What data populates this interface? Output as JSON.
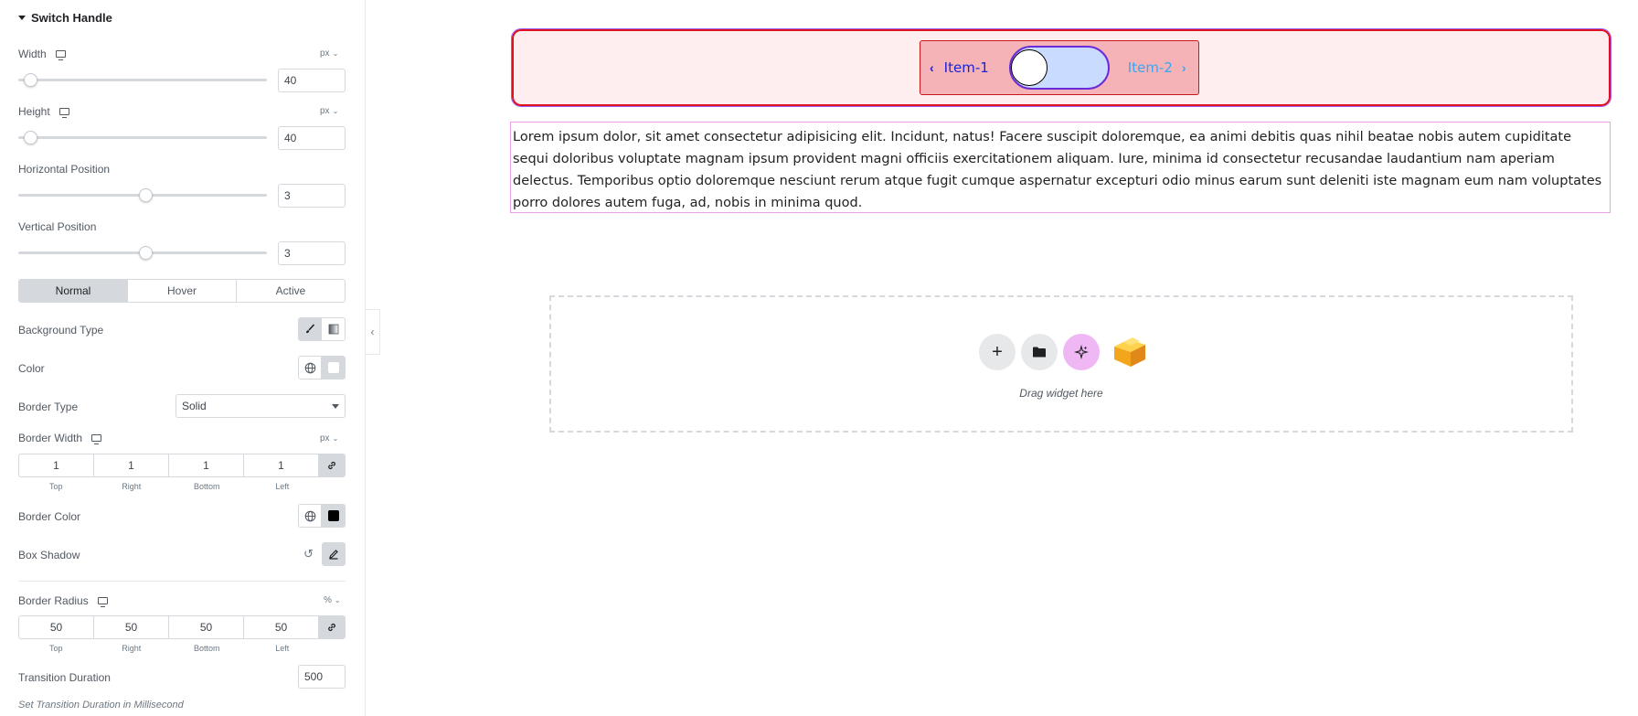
{
  "panel": {
    "section_title": "Switch Handle",
    "width": {
      "label": "Width",
      "unit": "px",
      "value": "40",
      "slider_fraction": 0.02
    },
    "height": {
      "label": "Height",
      "unit": "px",
      "value": "40",
      "slider_fraction": 0.02
    },
    "hpos": {
      "label": "Horizontal Position",
      "value": "3",
      "slider_fraction": 0.46
    },
    "vpos": {
      "label": "Vertical Position",
      "value": "3",
      "slider_fraction": 0.46
    },
    "tabs": [
      "Normal",
      "Hover",
      "Active"
    ],
    "active_tab": "Normal",
    "background_type_label": "Background Type",
    "color_label": "Color",
    "border_type": {
      "label": "Border Type",
      "value": "Solid"
    },
    "border_width": {
      "label": "Border Width",
      "unit": "px",
      "values": [
        "1",
        "1",
        "1",
        "1"
      ],
      "sides": [
        "Top",
        "Right",
        "Bottom",
        "Left"
      ]
    },
    "border_color_label": "Border Color",
    "border_color": "#000000",
    "box_shadow_label": "Box Shadow",
    "border_radius": {
      "label": "Border Radius",
      "unit": "%",
      "values": [
        "50",
        "50",
        "50",
        "50"
      ],
      "sides": [
        "Top",
        "Right",
        "Bottom",
        "Left"
      ]
    },
    "transition": {
      "label": "Transition Duration",
      "value": "500"
    },
    "transition_note": "Set Transition Duration in Millisecond"
  },
  "canvas": {
    "switch": {
      "item1": "Item-1",
      "item2": "Item-2",
      "item1_color": "#1a23d6",
      "item2_color": "#38a6f5"
    },
    "paragraph": "Lorem ipsum dolor, sit amet consectetur adipisicing elit. Incidunt, natus! Facere suscipit doloremque, ea animi debitis quas nihil beatae nobis autem cupiditate sequi doloribus voluptate magnam ipsum provident magni officiis exercitationem aliquam. Iure, minima id consectetur recusandae laudantium nam aperiam delectus. Temporibus optio doloremque nesciunt rerum atque fugit cumque aspernatur excepturi odio minus earum sunt deleniti iste magnam eum nam voluptates porro dolores autem fuga, ad, nobis in minima quod.",
    "drop_zone_text": "Drag widget here"
  }
}
